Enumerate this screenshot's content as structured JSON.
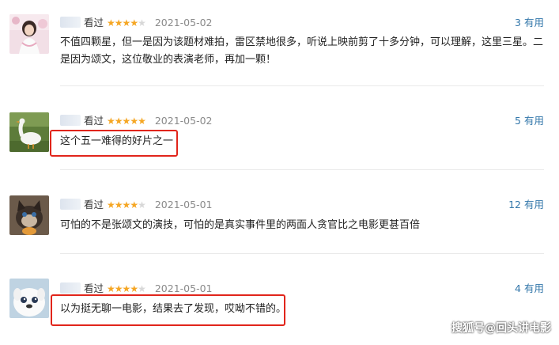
{
  "reviews": [
    {
      "status": "看过",
      "rating": 4,
      "date": "2021-05-02",
      "useful_count": "3",
      "useful_label": "有用",
      "text": "不值四颗星，但一是因为该题材难拍，雷区禁地很多，听说上映前剪了十多分钟，可以理解，这里三星。二是因为颂文，这位敬业的表演老师，再加一颗！",
      "avatar": "girl-portrait"
    },
    {
      "status": "看过",
      "rating": 5,
      "date": "2021-05-02",
      "useful_count": "5",
      "useful_label": "有用",
      "text": "这个五一难得的好片之一",
      "avatar": "goose"
    },
    {
      "status": "看过",
      "rating": 4,
      "date": "2021-05-01",
      "useful_count": "12",
      "useful_label": "有用",
      "text": "可怕的不是张颂文的演技，可怕的是真实事件里的两面人贪官比之电影更甚百倍",
      "avatar": "cat"
    },
    {
      "status": "看过",
      "rating": 4,
      "date": "2021-05-01",
      "useful_count": "4",
      "useful_label": "有用",
      "text": "以为挺无聊一电影，结果去了发现，哎呦不错的。",
      "avatar": "white-dog"
    }
  ],
  "watermark": "搜狐号@回头讲电影",
  "colors": {
    "star": "#f5a623",
    "link": "#3377aa",
    "highlight": "#e1251b"
  }
}
